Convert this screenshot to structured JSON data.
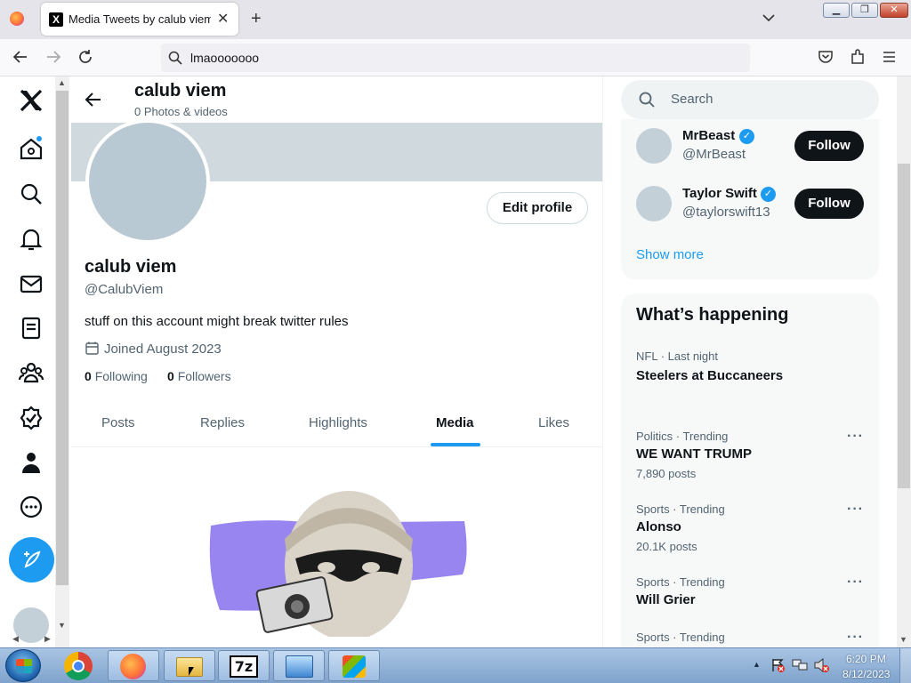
{
  "browser": {
    "tab_title": "Media Tweets by calub viem (@",
    "url": "lmaooooooo"
  },
  "profile": {
    "header_name": "calub viem",
    "header_sub": "0 Photos & videos",
    "name": "calub viem",
    "handle": "@CalubViem",
    "bio": "stuff on this account might break twitter rules",
    "joined": "Joined August 2023",
    "following_count": "0",
    "following_label": "Following",
    "followers_count": "0",
    "followers_label": "Followers",
    "edit_profile": "Edit profile"
  },
  "tabs": [
    "Posts",
    "Replies",
    "Highlights",
    "Media",
    "Likes"
  ],
  "active_tab": "Media",
  "search": {
    "placeholder": "Search"
  },
  "who_to_follow": [
    {
      "name": "MrBeast",
      "handle": "@MrBeast",
      "verified": true,
      "button": "Follow"
    },
    {
      "name": "Taylor Swift",
      "handle": "@taylorswift13",
      "verified": true,
      "button": "Follow"
    }
  ],
  "show_more": "Show more",
  "happening": {
    "title": "What’s happening",
    "items": [
      {
        "meta": "NFL · Last night",
        "name": "Steelers at Buccaneers",
        "posts": ""
      },
      {
        "meta": "Politics · Trending",
        "name": "WE WANT TRUMP",
        "posts": "7,890 posts"
      },
      {
        "meta": "Sports · Trending",
        "name": "Alonso",
        "posts": "20.1K posts"
      },
      {
        "meta": "Sports · Trending",
        "name": "Will Grier",
        "posts": ""
      },
      {
        "meta": "Sports · Trending",
        "name": "",
        "posts": ""
      }
    ]
  },
  "taskbar": {
    "time": "6:20 PM",
    "date": "8/12/2023"
  },
  "nav_icons": [
    "x-logo-icon",
    "home-icon",
    "explore-icon",
    "notifications-icon",
    "messages-icon",
    "lists-icon",
    "communities-icon",
    "verified-icon",
    "profile-icon",
    "more-icon",
    "compose-icon"
  ],
  "colors": {
    "accent": "#1d9bf0",
    "banner": "#cfd9de",
    "follow_bg": "#0f1419"
  }
}
